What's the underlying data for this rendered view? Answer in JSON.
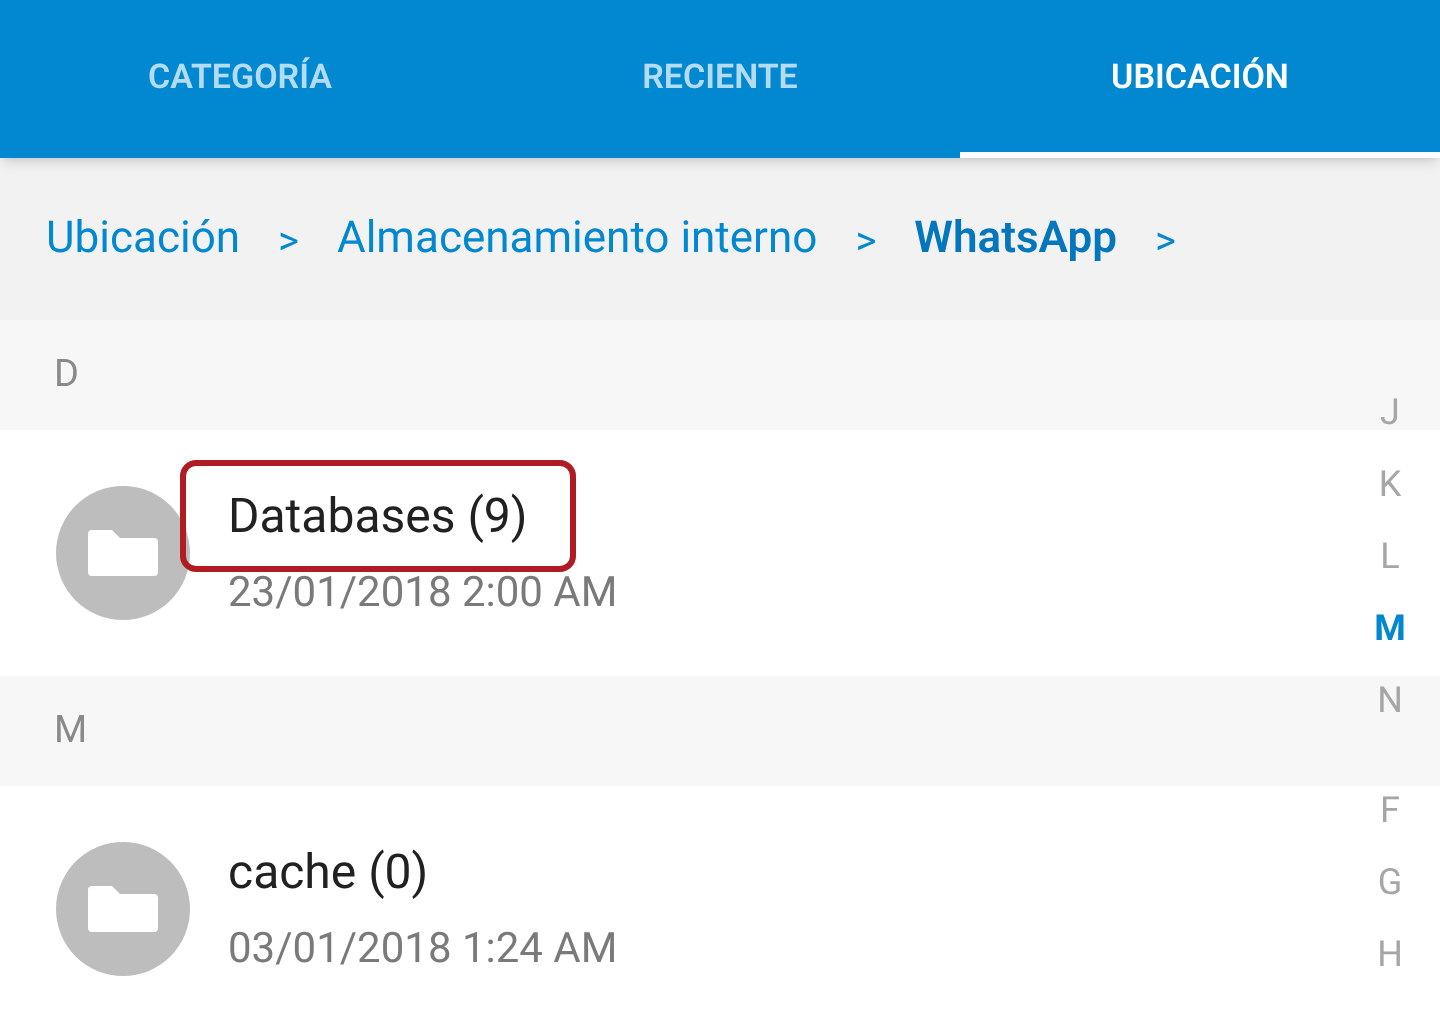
{
  "tabs": [
    {
      "label": "CATEGORÍA",
      "selected": false
    },
    {
      "label": "RECIENTE",
      "selected": false
    },
    {
      "label": "UBICACIÓN",
      "selected": true
    }
  ],
  "breadcrumb": [
    {
      "label": "Ubicación",
      "current": false
    },
    {
      "label": "Almacenamiento interno",
      "current": false
    },
    {
      "label": "WhatsApp",
      "current": true
    }
  ],
  "breadcrumb_separator": ">",
  "sections": [
    {
      "header": "D",
      "items": [
        {
          "name": "Databases (9)",
          "date": "23/01/2018 2:00 AM",
          "highlighted": true
        }
      ]
    },
    {
      "header": "M",
      "items": [
        {
          "name": "cache (0)",
          "date": "03/01/2018 1:24 AM",
          "highlighted": false
        }
      ]
    }
  ],
  "index_strip": {
    "upper": [
      {
        "letter": "J",
        "selected": false
      },
      {
        "letter": "K",
        "selected": false
      },
      {
        "letter": "L",
        "selected": false
      },
      {
        "letter": "M",
        "selected": true
      },
      {
        "letter": "N",
        "selected": false
      }
    ],
    "lower": [
      {
        "letter": "F",
        "selected": false
      },
      {
        "letter": "G",
        "selected": false
      },
      {
        "letter": "H",
        "selected": false
      }
    ]
  }
}
